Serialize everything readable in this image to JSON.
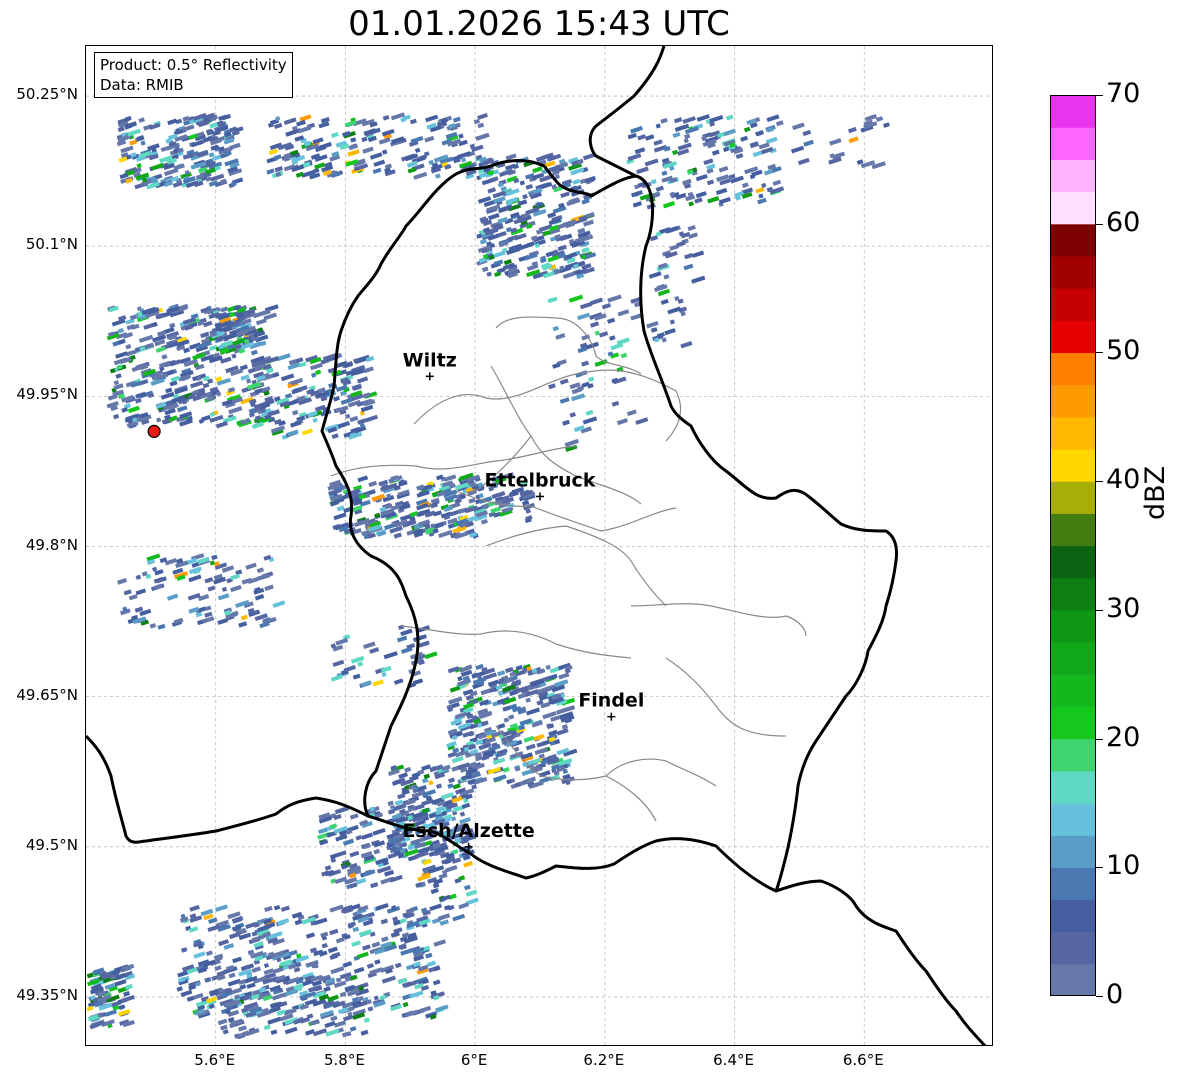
{
  "title": "01.01.2026 15:43 UTC",
  "info_box": {
    "product": "Product: 0.5° Reflectivity",
    "data": "Data: RMIB"
  },
  "map": {
    "lon_range": [
      5.4,
      6.8
    ],
    "lat_range": [
      49.3,
      50.3
    ],
    "lat_ticks": [
      {
        "value": 50.25,
        "label": "50.25°N"
      },
      {
        "value": 50.1,
        "label": "50.1°N"
      },
      {
        "value": 49.95,
        "label": "49.95°N"
      },
      {
        "value": 49.8,
        "label": "49.8°N"
      },
      {
        "value": 49.65,
        "label": "49.65°N"
      },
      {
        "value": 49.5,
        "label": "49.5°N"
      },
      {
        "value": 49.35,
        "label": "49.35°N"
      }
    ],
    "lon_ticks": [
      {
        "value": 5.6,
        "label": "5.6°E"
      },
      {
        "value": 5.8,
        "label": "5.8°E"
      },
      {
        "value": 6.0,
        "label": "6°E"
      },
      {
        "value": 6.2,
        "label": "6.2°E"
      },
      {
        "value": 6.4,
        "label": "6.4°E"
      },
      {
        "value": 6.6,
        "label": "6.6°E"
      }
    ],
    "grid": true,
    "cities": [
      {
        "name": "Wiltz",
        "lon": 5.93,
        "lat": 49.97
      },
      {
        "name": "Ettelbruck",
        "lon": 6.1,
        "lat": 49.85
      },
      {
        "name": "Findel",
        "lon": 6.21,
        "lat": 49.63
      },
      {
        "name": "Esch/Alzette",
        "lon": 5.99,
        "lat": 49.5
      }
    ],
    "radar_site": {
      "lon": 5.505,
      "lat": 49.915,
      "color": "#e8190f"
    }
  },
  "colorbar": {
    "label": "dBZ",
    "min": 0,
    "max": 70,
    "ticks": [
      "0",
      "10",
      "20",
      "30",
      "40",
      "50",
      "60",
      "70"
    ],
    "colors": [
      "#6677aa",
      "#5566a2",
      "#445ea0",
      "#4a78b0",
      "#5a9ec8",
      "#66c2dc",
      "#5fd8c4",
      "#3ed46e",
      "#14c81e",
      "#12b81c",
      "#10a818",
      "#0e9816",
      "#0c7e12",
      "#0a6412",
      "#437c10",
      "#a8ae08",
      "#ffd700",
      "#ffb800",
      "#ff9a00",
      "#ff7f00",
      "#e60000",
      "#c40000",
      "#a20000",
      "#7e0000",
      "#ffe0ff",
      "#ffb3ff",
      "#ff66ff",
      "#e834ef"
    ]
  }
}
